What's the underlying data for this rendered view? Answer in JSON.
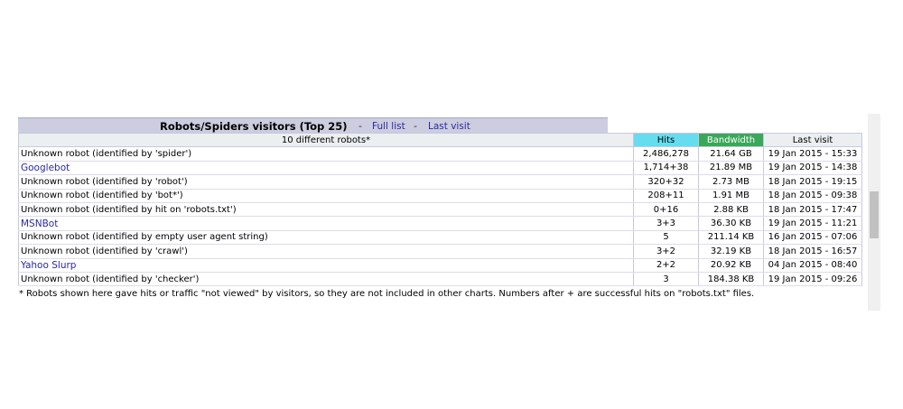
{
  "header": {
    "title": "Robots/Spiders visitors (Top 25)",
    "sep": "-",
    "full_list": "Full list",
    "last_visit": "Last visit"
  },
  "table": {
    "columns": {
      "name": "10 different robots*",
      "hits": "Hits",
      "bandwidth": "Bandwidth",
      "last_visit": "Last visit"
    },
    "column_colors": {
      "hits": "#66ddee",
      "bandwidth": "#3aa85a"
    },
    "rows": [
      {
        "name": "Unknown robot (identified by 'spider')",
        "is_link": false,
        "hits": "2,486,278",
        "bandwidth": "21.64 GB",
        "last_visit": "19 Jan 2015 - 15:33"
      },
      {
        "name": "Googlebot",
        "is_link": true,
        "hits": "1,714+38",
        "bandwidth": "21.89 MB",
        "last_visit": "19 Jan 2015 - 14:38"
      },
      {
        "name": "Unknown robot (identified by 'robot')",
        "is_link": false,
        "hits": "320+32",
        "bandwidth": "2.73 MB",
        "last_visit": "18 Jan 2015 - 19:15"
      },
      {
        "name": "Unknown robot (identified by 'bot*')",
        "is_link": false,
        "hits": "208+11",
        "bandwidth": "1.91 MB",
        "last_visit": "18 Jan 2015 - 09:38"
      },
      {
        "name": "Unknown robot (identified by hit on 'robots.txt')",
        "is_link": false,
        "hits": "0+16",
        "bandwidth": "2.88 KB",
        "last_visit": "18 Jan 2015 - 17:47"
      },
      {
        "name": "MSNBot",
        "is_link": true,
        "hits": "3+3",
        "bandwidth": "36.30 KB",
        "last_visit": "19 Jan 2015 - 11:21"
      },
      {
        "name": "Unknown robot (identified by empty user agent string)",
        "is_link": false,
        "hits": "5",
        "bandwidth": "211.14 KB",
        "last_visit": "16 Jan 2015 - 07:06"
      },
      {
        "name": "Unknown robot (identified by 'crawl')",
        "is_link": false,
        "hits": "3+2",
        "bandwidth": "32.19 KB",
        "last_visit": "18 Jan 2015 - 16:57"
      },
      {
        "name": "Yahoo Slurp",
        "is_link": true,
        "hits": "2+2",
        "bandwidth": "20.92 KB",
        "last_visit": "04 Jan 2015 - 08:40"
      },
      {
        "name": "Unknown robot (identified by 'checker')",
        "is_link": false,
        "hits": "3",
        "bandwidth": "184.38 KB",
        "last_visit": "19 Jan 2015 - 09:26"
      }
    ]
  },
  "footnote": "* Robots shown here gave hits or traffic \"not viewed\" by visitors, so they are not included in other charts. Numbers after + are successful hits on \"robots.txt\" files."
}
